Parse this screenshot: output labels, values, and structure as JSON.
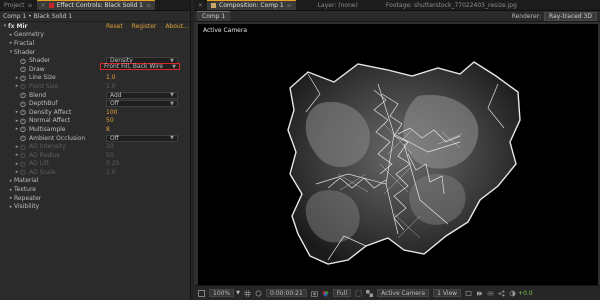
{
  "left_tabs": {
    "project": "Project",
    "effect_controls": "Effect Controls: Black Solid 1"
  },
  "effect_header": {
    "layer_path": "Comp 1 • Black Solid 1"
  },
  "effect": {
    "name": "Mir",
    "reset": "Reset",
    "register": "Register",
    "about": "About..."
  },
  "groups": [
    "Geometry",
    "Fractal",
    "Shader",
    "Material",
    "Texture",
    "Repeater",
    "Visibility"
  ],
  "params": {
    "shader": {
      "label": "Shader",
      "value": "Density"
    },
    "draw": {
      "label": "Draw",
      "value": "Front Fill, Back Wire"
    },
    "line_size": {
      "label": "Line Size",
      "value": "1.0"
    },
    "point_size": {
      "label": "Point Size",
      "value": "1.0"
    },
    "blend": {
      "label": "Blend",
      "value": "Add"
    },
    "depthbuf": {
      "label": "DepthBuf",
      "value": "Off"
    },
    "density_affect": {
      "label": "Density Affect",
      "value": "100"
    },
    "normal_affect": {
      "label": "Normal Affect",
      "value": "50"
    },
    "multisample": {
      "label": "Multisample",
      "value": "8"
    },
    "ambient_occlusion": {
      "label": "Ambient Occlusion",
      "value": "Off"
    },
    "ao_intensity": {
      "label": "AO Intensity",
      "value": "10"
    },
    "ao_radius": {
      "label": "AO Radius",
      "value": "50"
    },
    "ao_lift": {
      "label": "AO Lift",
      "value": "0.25"
    },
    "ao_scale": {
      "label": "AO Scale",
      "value": "1.0"
    }
  },
  "right_tabs": {
    "composition": "Composition: Comp 1",
    "layer": "Layer: (none)",
    "footage": "Footage: shutterstock_77022403_resize.jpg"
  },
  "comp_sub": {
    "chip": "Comp 1",
    "renderer_label": "Renderer:",
    "renderer_value": "Ray-traced 3D"
  },
  "viewer": {
    "camera_label": "Active Camera"
  },
  "bottom_bar": {
    "zoom": "100%",
    "timecode": "0:00:00:21",
    "resolution": "Full",
    "camera": "Active Camera",
    "views": "1 View",
    "exposure": "+0.0"
  },
  "colors": {
    "accent_orange": "#e0a23a",
    "highlight_red": "#d9262c",
    "exposure_green": "#7ec24b"
  }
}
